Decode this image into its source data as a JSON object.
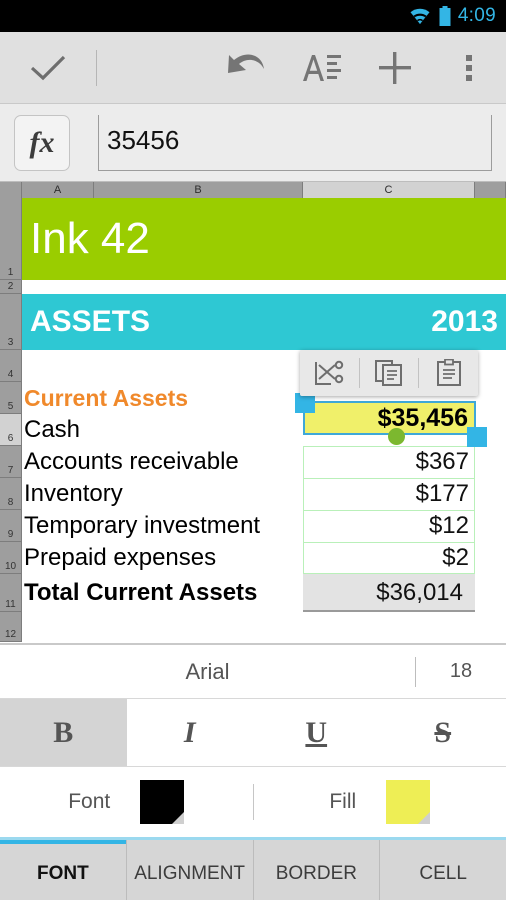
{
  "statusbar": {
    "time": "4:09",
    "wifi_icon": "wifi-icon",
    "battery_icon": "battery-icon",
    "accent": "#33b5e5"
  },
  "actionbar": {
    "done_icon": "check-icon",
    "undo_icon": "undo-icon",
    "text_format_icon": "text-format-icon",
    "add_icon": "plus-icon",
    "overflow_icon": "overflow-menu-icon"
  },
  "formula": {
    "fx_label": "fx",
    "value": "35456",
    "placeholder": ""
  },
  "grid": {
    "columns": [
      {
        "label": "A",
        "selected": false
      },
      {
        "label": "B",
        "selected": false
      },
      {
        "label": "C",
        "selected": true
      },
      {
        "label": "",
        "selected": false
      }
    ],
    "rows": [
      "1",
      "2",
      "3",
      "4",
      "5",
      "6",
      "7",
      "8",
      "9",
      "10",
      "11",
      "12"
    ],
    "active_row": "6",
    "title_band": {
      "text": "Ink 42",
      "color": "#9acd00"
    },
    "section_band": {
      "left": "ASSETS",
      "right": "2013",
      "color": "#2ec8d3"
    },
    "section_heading": {
      "text": "Current Assets",
      "color": "#f0892b"
    },
    "items": [
      {
        "label": "Cash",
        "value": "$35,456"
      },
      {
        "label": "Accounts receivable",
        "value": "$367"
      },
      {
        "label": "Inventory",
        "value": "$177"
      },
      {
        "label": "Temporary investment",
        "value": "$12"
      },
      {
        "label": "Prepaid expenses",
        "value": "$2"
      }
    ],
    "total": {
      "label": "Total Current Assets",
      "value": "$36,014"
    },
    "selected_cell": {
      "ref": "C6",
      "display": "$35,456",
      "fill": "#f0f06a",
      "border": "#3fa8d8"
    },
    "fill_handle_color": "#7cb82f"
  },
  "clipboard": {
    "cut_icon": "cut-icon",
    "copy_icon": "copy-icon",
    "paste_icon": "paste-icon"
  },
  "font_panel": {
    "font_name": "Arial",
    "font_size": "18",
    "bold_label": "B",
    "italic_label": "I",
    "underline_label": "U",
    "strike_label": "S",
    "bold_active": true,
    "font_color_label": "Font",
    "font_color": "#000000",
    "fill_color_label": "Fill",
    "fill_color": "#eeee55"
  },
  "tabs": [
    {
      "label": "FONT",
      "active": true
    },
    {
      "label": "ALIGNMENT",
      "active": false
    },
    {
      "label": "BORDER",
      "active": false
    },
    {
      "label": "CELL",
      "active": false
    }
  ]
}
